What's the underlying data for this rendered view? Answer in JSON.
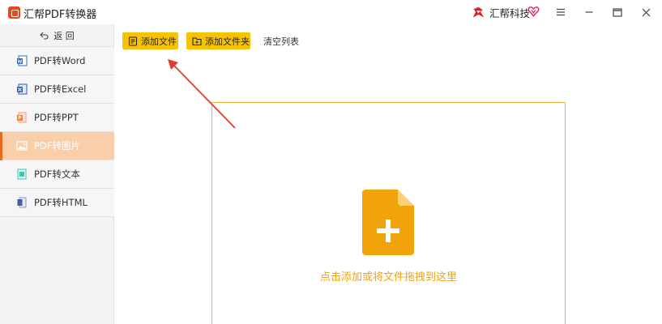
{
  "titlebar": {
    "app_title": "汇帮PDF转换器",
    "brand_name": "汇帮科技",
    "icons": [
      "app-logo-icon",
      "brand-logo-icon",
      "vip-heart-icon",
      "menu-icon",
      "minimize-icon",
      "maximize-icon",
      "close-icon"
    ]
  },
  "sidebar": {
    "back_label": "返 回",
    "items": [
      {
        "label": "PDF转Word",
        "icon": "word-icon",
        "color": "#2f6fc7",
        "active": false
      },
      {
        "label": "PDF转Excel",
        "icon": "excel-icon",
        "color": "#2c63b5",
        "active": false
      },
      {
        "label": "PDF转PPT",
        "icon": "ppt-icon",
        "color": "#f07a3a",
        "active": false
      },
      {
        "label": "PDF转图片",
        "icon": "image-icon",
        "color": "#ffffff",
        "active": true
      },
      {
        "label": "PDF转文本",
        "icon": "text-icon",
        "color": "#3fc7b2",
        "active": false
      },
      {
        "label": "PDF转HTML",
        "icon": "html-icon",
        "color": "#4a5d9e",
        "active": false
      }
    ]
  },
  "toolbar": {
    "add_file_label": "添加文件",
    "add_folder_label": "添加文件夹",
    "clear_list_label": "清空列表"
  },
  "dropzone": {
    "text": "点击添加或将文件拖拽到这里"
  },
  "colors": {
    "accent_yellow": "#f7c200",
    "active_bg": "#f8ceab",
    "drop_border": "#f2b43c",
    "file_icon": "#f0a30a",
    "drop_text": "#f0a215",
    "arrow": "#e23b2e"
  }
}
